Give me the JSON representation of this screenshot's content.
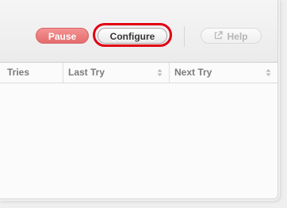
{
  "toolbar": {
    "pause_label": "Pause",
    "configure_label": "Configure",
    "help_label": "Help",
    "help_icon": "external-link-icon"
  },
  "table": {
    "columns": [
      {
        "label": "Tries",
        "sortable": false
      },
      {
        "label": "Last Try",
        "sortable": true
      },
      {
        "label": "Next Try",
        "sortable": true
      }
    ],
    "rows": []
  },
  "colors": {
    "pause_button": "#e46c6c",
    "highlight_ring": "#e00012"
  }
}
